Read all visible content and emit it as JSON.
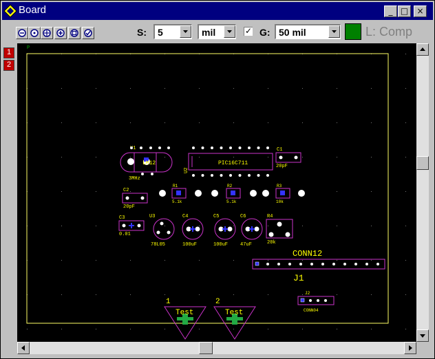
{
  "window": {
    "title": "Board",
    "icon": "diamond-app-icon",
    "controls": [
      "minimize",
      "maximize",
      "close"
    ]
  },
  "toolbar": {
    "zoom_tools": [
      "zoom-out-icon",
      "zoom-center-icon",
      "zoom-extents-icon",
      "zoom-in-icon",
      "zoom-window-icon",
      "zoom-check-icon"
    ],
    "snap_label": "S:",
    "snap_value": "5",
    "unit_value": "mil",
    "grid_checked": "✓",
    "grid_label": "G:",
    "grid_value": "50 mil",
    "layer_color": "#008000",
    "layer_text": "L: Comp"
  },
  "layer_buttons": [
    {
      "label": "1",
      "color": "#c00000"
    },
    {
      "label": "2",
      "color": "#c00000"
    }
  ],
  "board": {
    "origin_marker": "P",
    "components": {
      "y1_ref": "Y1",
      "y1_label": "LM12",
      "y1_value": "3MHz",
      "u2_ref": "U2",
      "u2_value": "PIC16C711",
      "c1_ref": "C1",
      "c1_value": "20pF",
      "c2_ref": "C2",
      "c2_value": "20pF",
      "r1_ref": "R1",
      "r1_value": "5.1k",
      "r2_ref": "R2",
      "r2_value": "5.1k",
      "r3_ref": "R3",
      "r3_value": "10k",
      "c3_ref": "C3",
      "c3_value": "0.01",
      "u3_ref": "U3",
      "u3_value": "78L05",
      "c4_ref": "C4",
      "c4_value": "100uF",
      "c5_ref": "C5",
      "c5_value": "100uF",
      "c6_ref": "C6",
      "c6_value": "47uF",
      "r4_ref": "R4",
      "r4_value": "20k",
      "conn12_label": "CONN12",
      "j1_ref": "J1",
      "j2_ref": "J2",
      "j2_value": "CONN04",
      "tp1_num": "1",
      "tp1_label": "Test",
      "tp2_num": "2",
      "tp2_label": "Test"
    }
  },
  "colors": {
    "board_bg": "#000000",
    "outline": "#ffff66",
    "silkscreen": "#cc33cc",
    "pad": "#ffffff",
    "text": "#ffff00",
    "title_bar": "#000080"
  }
}
